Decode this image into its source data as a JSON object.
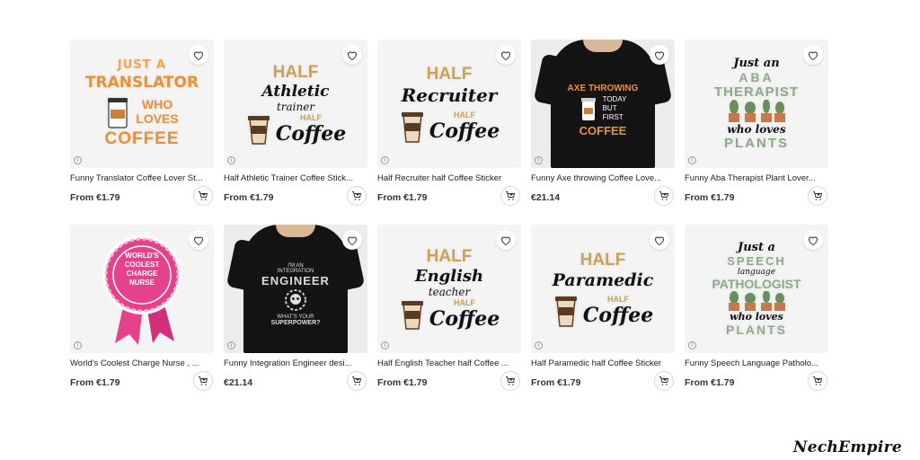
{
  "products": [
    {
      "title": "Funny Translator Coffee Lover St...",
      "price": "From €1.79",
      "art": "translator"
    },
    {
      "title": "Half Athletic Trainer Coffee Stick...",
      "price": "From €1.79",
      "art": "athletic"
    },
    {
      "title": "Half Recruiter half Coffee Sticker",
      "price": "From €1.79",
      "art": "recruiter"
    },
    {
      "title": "Funny Axe throwing Coffee Love...",
      "price": "€21.14",
      "art": "axe"
    },
    {
      "title": "Funny Aba Therapist Plant Lover...",
      "price": "From €1.79",
      "art": "aba"
    },
    {
      "title": "World's Coolest Charge Nurse , ...",
      "price": "From €1.79",
      "art": "nurse"
    },
    {
      "title": "Funny Integration Engineer desi...",
      "price": "€21.14",
      "art": "engineer"
    },
    {
      "title": "Half English Teacher half Coffee ...",
      "price": "From €1.79",
      "art": "english"
    },
    {
      "title": "Half Paramedic half Coffee Sticker",
      "price": "From €1.79",
      "art": "paramedic"
    },
    {
      "title": "Funny Speech Language Patholo...",
      "price": "From €1.79",
      "art": "speech"
    }
  ],
  "art_text": {
    "translator": [
      "JUST A",
      "TRANSLATOR",
      "WHO",
      "LOVES",
      "COFFEE"
    ],
    "athletic": [
      "HALF",
      "Athletic",
      "trainer",
      "HALF",
      "Coffee"
    ],
    "recruiter": [
      "HALF",
      "Recruiter",
      "HALF",
      "Coffee"
    ],
    "axe": [
      "AXE THROWING",
      "TODAY",
      "BUT",
      "FIRST",
      "COFFEE"
    ],
    "aba": [
      "Just an",
      "ABA",
      "THERAPIST",
      "who loves",
      "PLANTS"
    ],
    "nurse": [
      "WORLD'S",
      "COOLEST",
      "CHARGE",
      "NURSE"
    ],
    "engineer": [
      "I'M AN",
      "INTEGRATION",
      "ENGINEER",
      "WHAT'S YOUR",
      "SUPERPOWER?"
    ],
    "english": [
      "HALF",
      "English",
      "teacher",
      "HALF",
      "Coffee"
    ],
    "paramedic": [
      "HALF",
      "Paramedic",
      "HALF",
      "Coffee"
    ],
    "speech": [
      "Just a",
      "SPEECH",
      "language",
      "PATHOLOGIST",
      "who loves",
      "PLANTS"
    ]
  },
  "info_glyph": "i",
  "watermark": "NechEmpire",
  "icons": {
    "favorite": "heart-icon",
    "cart": "add-to-cart-icon",
    "info": "info-icon"
  },
  "colors": {
    "card_bg": "#f4f4f5",
    "orange": "#e8913a",
    "brown": "#5a3a22",
    "sage": "#8fa88a",
    "pink": "#e6418b",
    "gold": "#c9a25a"
  }
}
